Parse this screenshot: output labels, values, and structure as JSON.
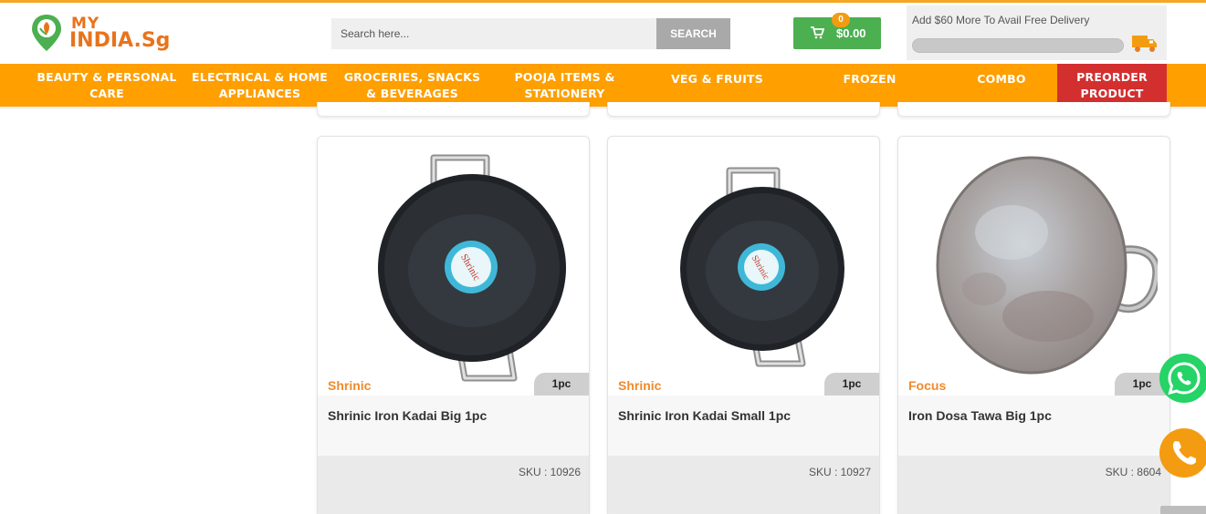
{
  "header": {
    "logo_line1": "MY",
    "logo_line2": "INDIA",
    "logo_suffix": ".Sg",
    "search_placeholder": "Search here...",
    "search_button": "SEARCH",
    "cart_count": "0",
    "cart_total": "$0.00",
    "delivery_message": "Add $60 More To Avail Free Delivery",
    "delivery_progress": 0
  },
  "nav": {
    "items": [
      {
        "line1": "BEAUTY & PERSONAL",
        "line2": "CARE"
      },
      {
        "line1": "ELECTRICAL & HOME",
        "line2": "APPLIANCES"
      },
      {
        "line1": "GROCERIES, SNACKS",
        "line2": "& BEVERAGES"
      },
      {
        "line1": "POOJA ITEMS &",
        "line2": "STATIONERY"
      },
      {
        "line1": "VEG & FRUITS",
        "line2": ""
      },
      {
        "line1": "FROZEN",
        "line2": ""
      },
      {
        "line1": "COMBO",
        "line2": ""
      },
      {
        "line1": "PREORDER",
        "line2": "PRODUCT"
      }
    ]
  },
  "products": [
    {
      "brand": "Shrinic",
      "qty": "1pc",
      "title": "Shrinic Iron Kadai Big 1pc",
      "sku": "SKU : 10926",
      "label_on_image": "Shrinic"
    },
    {
      "brand": "Shrinic",
      "qty": "1pc",
      "title": "Shrinic Iron Kadai Small 1pc",
      "sku": "SKU : 10927",
      "label_on_image": "Shrinic"
    },
    {
      "brand": "Focus",
      "qty": "1pc",
      "title": "Iron Dosa Tawa Big 1pc",
      "sku": "SKU : 8604"
    }
  ],
  "colors": {
    "nav_bg": "#ff9f00",
    "preorder_bg": "#d32f2f",
    "cart_bg": "#4caf50",
    "brand_text": "#f08a2c"
  },
  "icons": [
    "logo-pin-icon",
    "cart-icon",
    "truck-icon",
    "whatsapp-icon",
    "phone-icon"
  ]
}
